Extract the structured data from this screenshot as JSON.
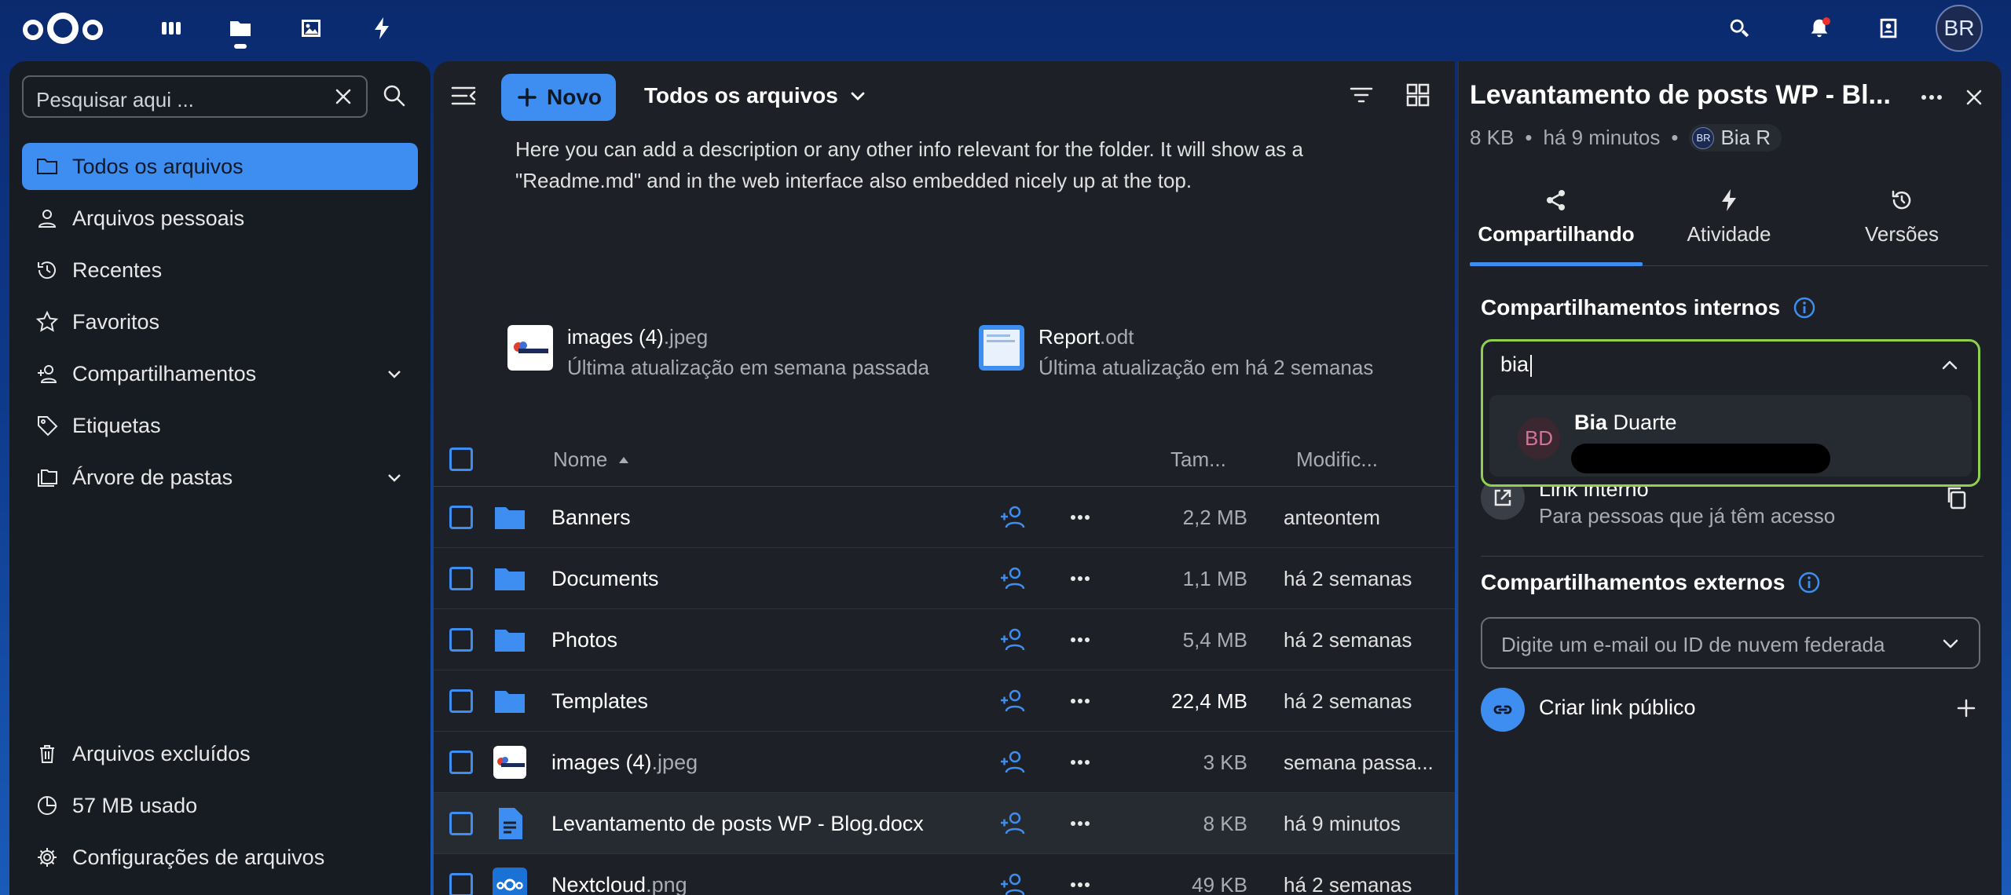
{
  "topbar": {
    "avatar_initials": "BR",
    "apps": [
      "dashboard-icon",
      "files-icon",
      "photos-icon",
      "activity-icon"
    ],
    "right_icons": [
      "search-icon",
      "notifications-icon",
      "contacts-icon"
    ]
  },
  "sidebar": {
    "search_placeholder": "Pesquisar aqui ...",
    "items": [
      {
        "label": "Todos os arquivos",
        "icon": "folder-icon",
        "active": true
      },
      {
        "label": "Arquivos pessoais",
        "icon": "person-icon"
      },
      {
        "label": "Recentes",
        "icon": "history-icon"
      },
      {
        "label": "Favoritos",
        "icon": "star-icon"
      },
      {
        "label": "Compartilhamentos",
        "icon": "share-icon",
        "expandable": true
      },
      {
        "label": "Etiquetas",
        "icon": "tag-icon"
      },
      {
        "label": "Árvore de pastas",
        "icon": "folder-tree-icon",
        "expandable": true
      }
    ],
    "footer": [
      {
        "label": "Arquivos excluídos",
        "icon": "trash-icon"
      },
      {
        "label": "57 MB usado",
        "icon": "pie-icon"
      },
      {
        "label": "Configurações de arquivos",
        "icon": "gear-icon"
      }
    ]
  },
  "main": {
    "new_label": "Novo",
    "breadcrumb": "Todos os arquivos",
    "readme": "Here you can add a description or any other info relevant for the folder. It will show as a \"Readme.md\" and in the web interface also embedded nicely up at the top.",
    "recent": [
      {
        "name": "images (4)",
        "ext": ".jpeg",
        "sub": "Última atualização em semana passada"
      },
      {
        "name": "Report",
        "ext": ".odt",
        "sub": "Última atualização em há 2 semanas"
      }
    ],
    "headers": {
      "name": "Nome",
      "size": "Tam...",
      "modified": "Modific..."
    },
    "rows": [
      {
        "name": "Banners",
        "ext": "",
        "size": "2,2 MB",
        "modified": "anteontem",
        "type": "folder"
      },
      {
        "name": "Documents",
        "ext": "",
        "size": "1,1 MB",
        "modified": "há 2 semanas",
        "type": "folder"
      },
      {
        "name": "Photos",
        "ext": "",
        "size": "5,4 MB",
        "modified": "há 2 semanas",
        "type": "folder"
      },
      {
        "name": "Templates",
        "ext": "",
        "size": "22,4 MB",
        "modified": "há 2 semanas",
        "type": "folder"
      },
      {
        "name": "images (4)",
        "ext": ".jpeg",
        "size": "3 KB",
        "modified": "semana passa...",
        "type": "image"
      },
      {
        "name": "Levantamento de posts WP - Blog.docx",
        "ext": "",
        "size": "8 KB",
        "modified": "há 9 minutos",
        "type": "doc"
      },
      {
        "name": "Nextcloud",
        "ext": ".png",
        "size": "49 KB",
        "modified": "há 2 semanas",
        "type": "nextcloud"
      }
    ]
  },
  "panel": {
    "title": "Levantamento de posts WP - Bl...",
    "size": "8 KB",
    "time": "há 9 minutos",
    "owner_initials": "BR",
    "owner": "Bia R",
    "tabs": [
      "Compartilhando",
      "Atividade",
      "Versões"
    ],
    "internal_title": "Compartilhamentos internos",
    "search_value": "bia",
    "suggestion_initials": "BD",
    "suggestion_first": "Bia",
    "suggestion_last": " Duarte",
    "internal_link_title": "Link interno",
    "internal_link_sub": "Para pessoas que já têm acesso",
    "external_title": "Compartilhamentos externos",
    "external_placeholder": "Digite um e-mail ou ID de nuvem federada",
    "public_link": "Criar link público"
  },
  "colors": {
    "accent": "#3d8ef0",
    "focus": "#8fd14f"
  }
}
